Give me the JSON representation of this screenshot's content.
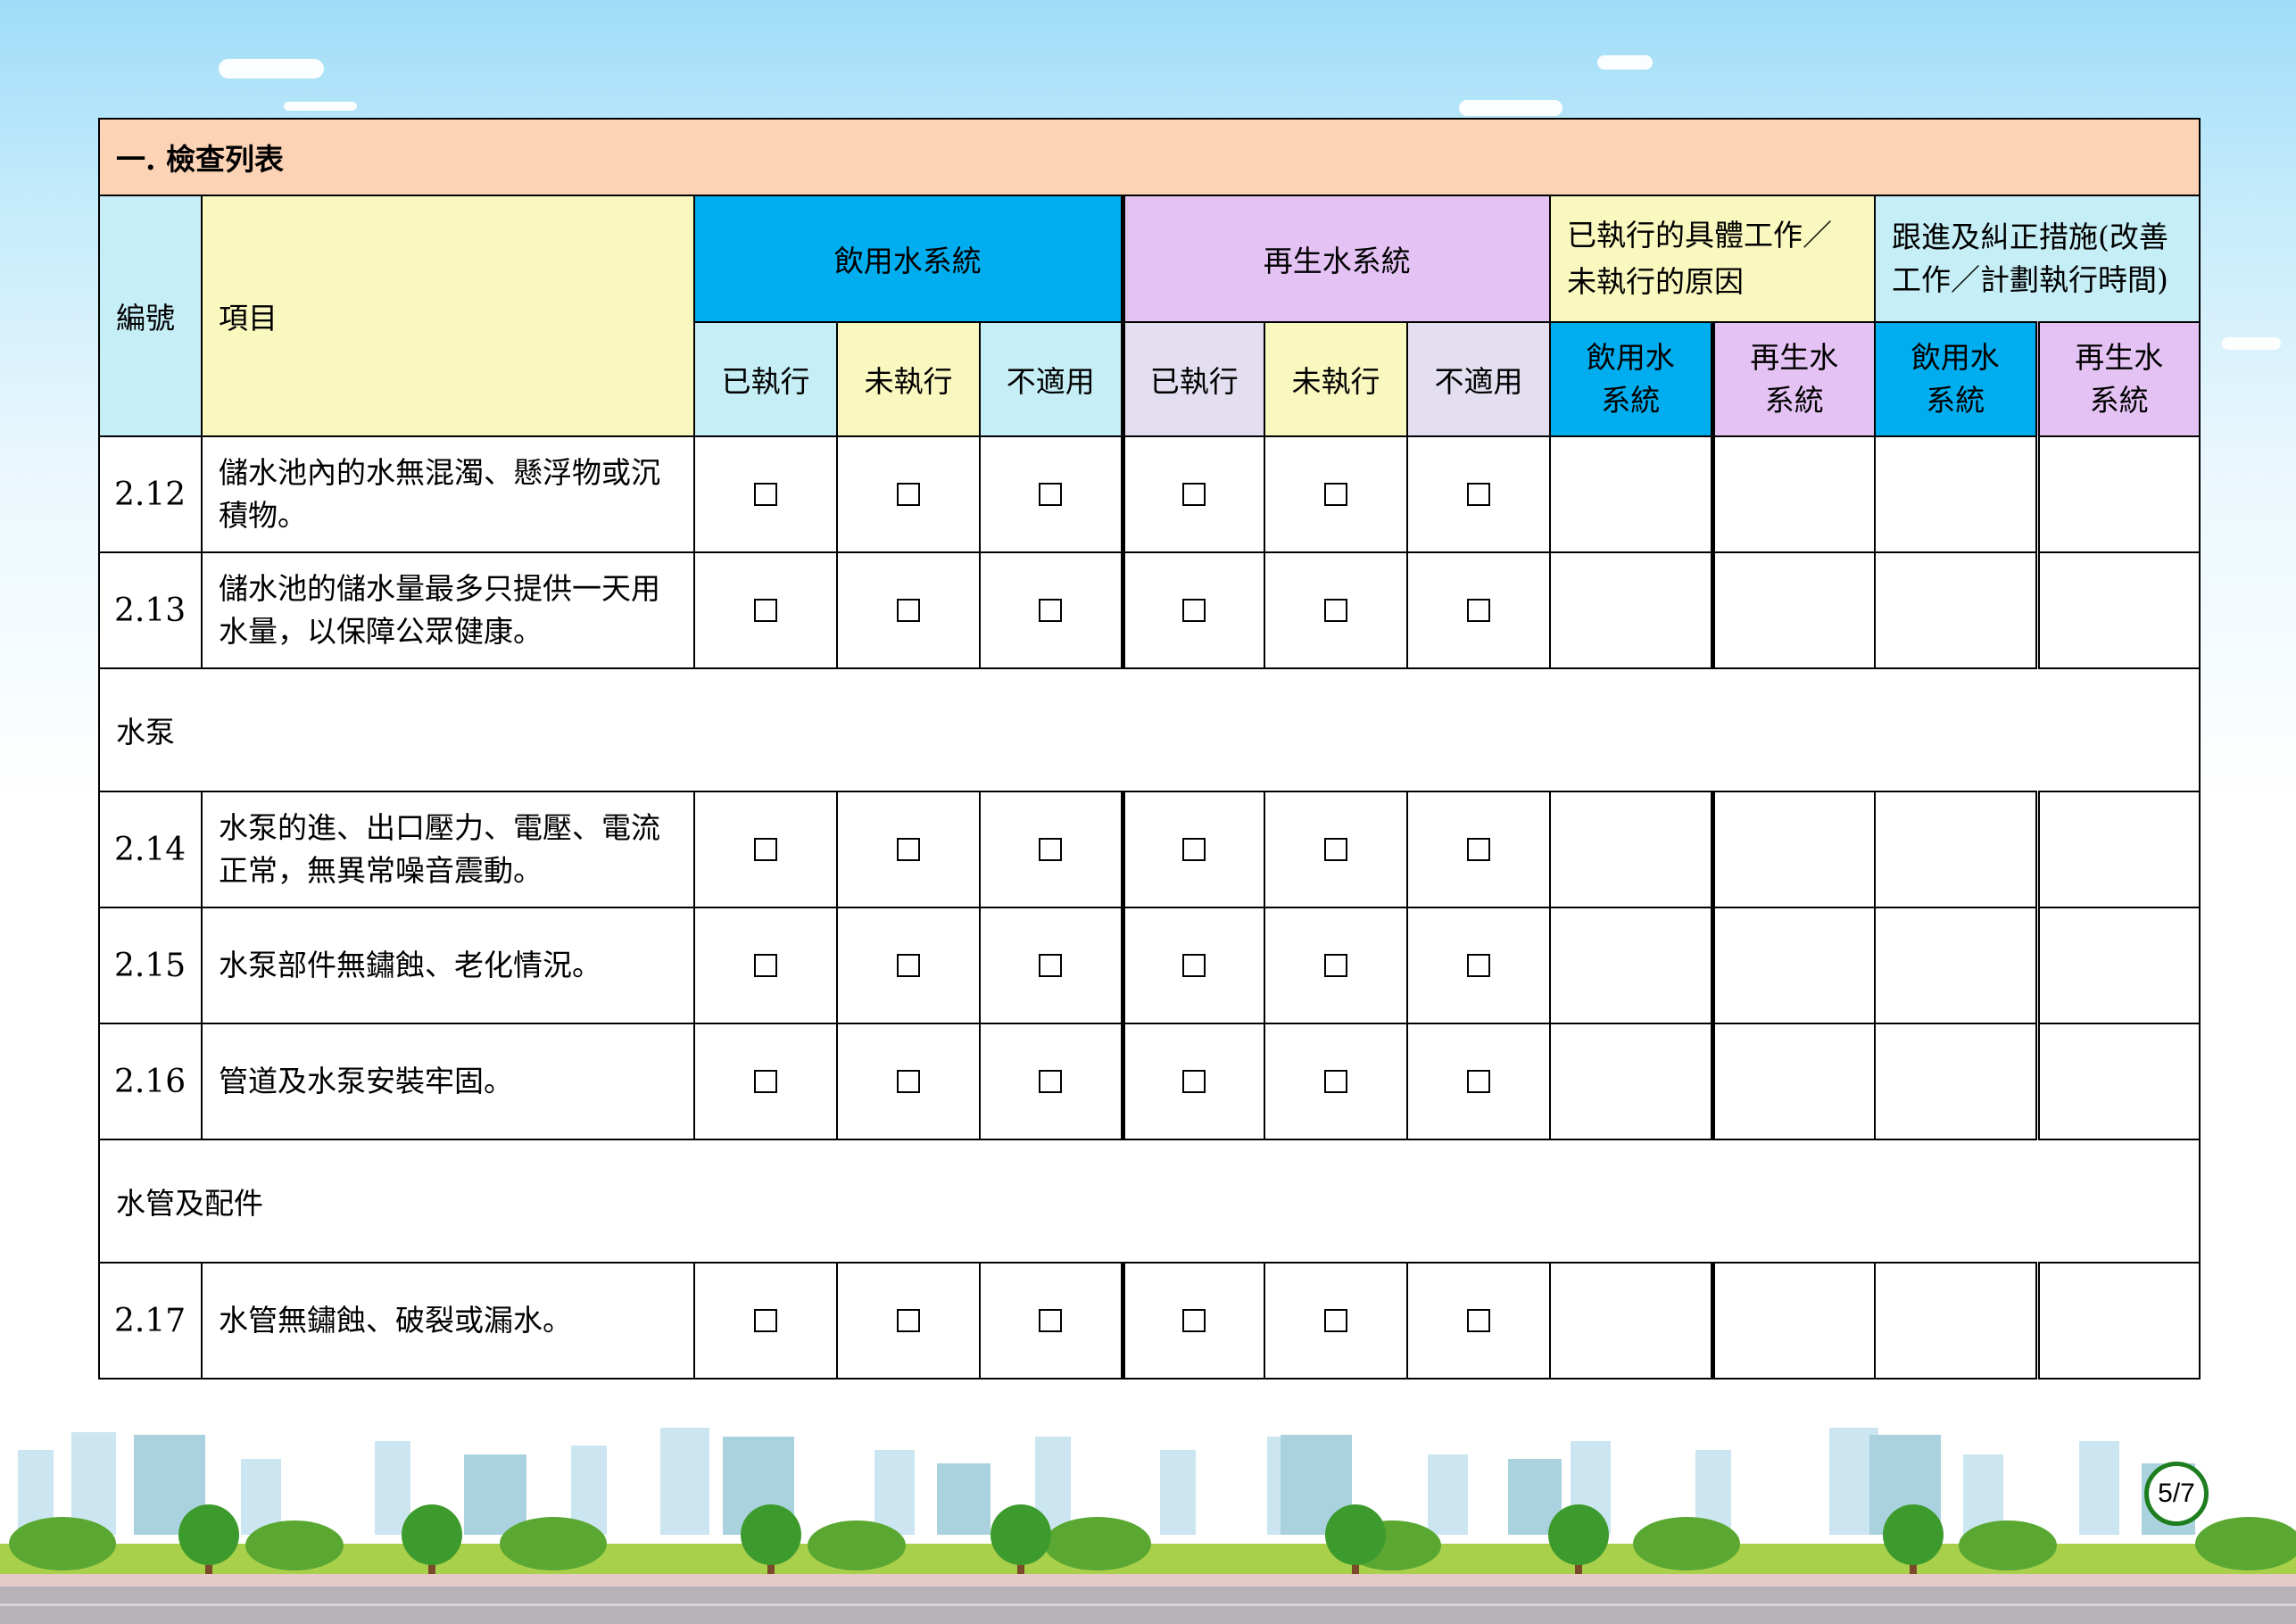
{
  "section_title": "一. 檢查列表",
  "headers": {
    "number": "編號",
    "item": "項目",
    "potable": "飲用水系統",
    "recycled": "再生水系統",
    "reason": "已執行的具體工作／未執行的原因",
    "follow_up": "跟進及糾正措施(改善工作／計劃執行時間)",
    "sub": [
      "已執行",
      "未執行",
      "不適用",
      "已執行",
      "未執行",
      "不適用"
    ],
    "sub_potable": "飲用水系統",
    "sub_recycled": "再生水系統"
  },
  "rows": [
    {
      "type": "item",
      "number": "2.12",
      "item": "儲水池內的水無混濁、懸浮物或沉積物。"
    },
    {
      "type": "item",
      "number": "2.13",
      "item": "儲水池的儲水量最多只提供一天用水量，以保障公眾健康。"
    },
    {
      "type": "section",
      "label": "水泵"
    },
    {
      "type": "item",
      "number": "2.14",
      "item": "水泵的進、出口壓力、電壓、電流正常，無異常噪音震動。"
    },
    {
      "type": "item",
      "number": "2.15",
      "item": "水泵部件無鏽蝕、老化情況。"
    },
    {
      "type": "item",
      "number": "2.16",
      "item": "管道及水泵安裝牢固。"
    },
    {
      "type": "section",
      "label": "水管及配件"
    },
    {
      "type": "item",
      "number": "2.17",
      "item": "水管無鏽蝕、破裂或漏水。"
    }
  ],
  "page_number": "5/7",
  "colors": {
    "title_bg": "#fcd3b5",
    "potable": "#00adee",
    "recycled": "#e4c3f4",
    "light_cyan": "#c5eef6",
    "light_yellow": "#f9f8bf",
    "light_lavender": "#e4dff0"
  }
}
